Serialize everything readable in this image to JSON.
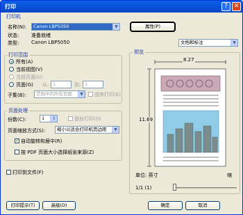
{
  "window": {
    "title": "打印",
    "help": "?",
    "close": "✕"
  },
  "printer": {
    "group_title": "打印机",
    "name_label": "名称(N):",
    "name_value": "Canon LBP5050",
    "properties_button": "属性(P)",
    "status_label": "状态:",
    "status_value": "准备就绪",
    "type_label": "类型:",
    "type_value": "Canon LBP5050",
    "comments_value": "文档和标注"
  },
  "range": {
    "group_title": "打印范围",
    "all": "所有(A)",
    "current_view": "当前视图(V)",
    "current_page": "当前页面(U)",
    "pages": "页面(G)",
    "from_label": "从:",
    "from_value": "1",
    "to_label": "到:",
    "to_value": "1",
    "subset_label": "子集(B):",
    "subset_value": "范围中的所有页面",
    "reverse": "逆序打印(E)"
  },
  "handling": {
    "group_title": "页面处理",
    "copies_label": "份数(C):",
    "copies_value": "1",
    "collate": "逐份打印(O)",
    "scaling_label": "页面缩放方式(S):",
    "scaling_value": "缩小以适合打印机页边距",
    "auto_rotate": "自动旋转和居中(R)",
    "pdf_paper": "按 PDF 页面大小选择纸张来源(Z)"
  },
  "print_to_file": "打印到文件(F)",
  "preview": {
    "group_title": "预览",
    "width": "8.27",
    "height": "11.69",
    "units": "单位: 英寸",
    "zoom": "缩",
    "page_counter": "1/1 (1)"
  },
  "buttons": {
    "tips": "打印提示(T)",
    "advanced": "高级(D)",
    "ok": "确定",
    "cancel": "取消"
  },
  "colors": {
    "accent": "#1f3ca8",
    "title_bar": "#0a5ee8",
    "close": "#d6451f"
  }
}
